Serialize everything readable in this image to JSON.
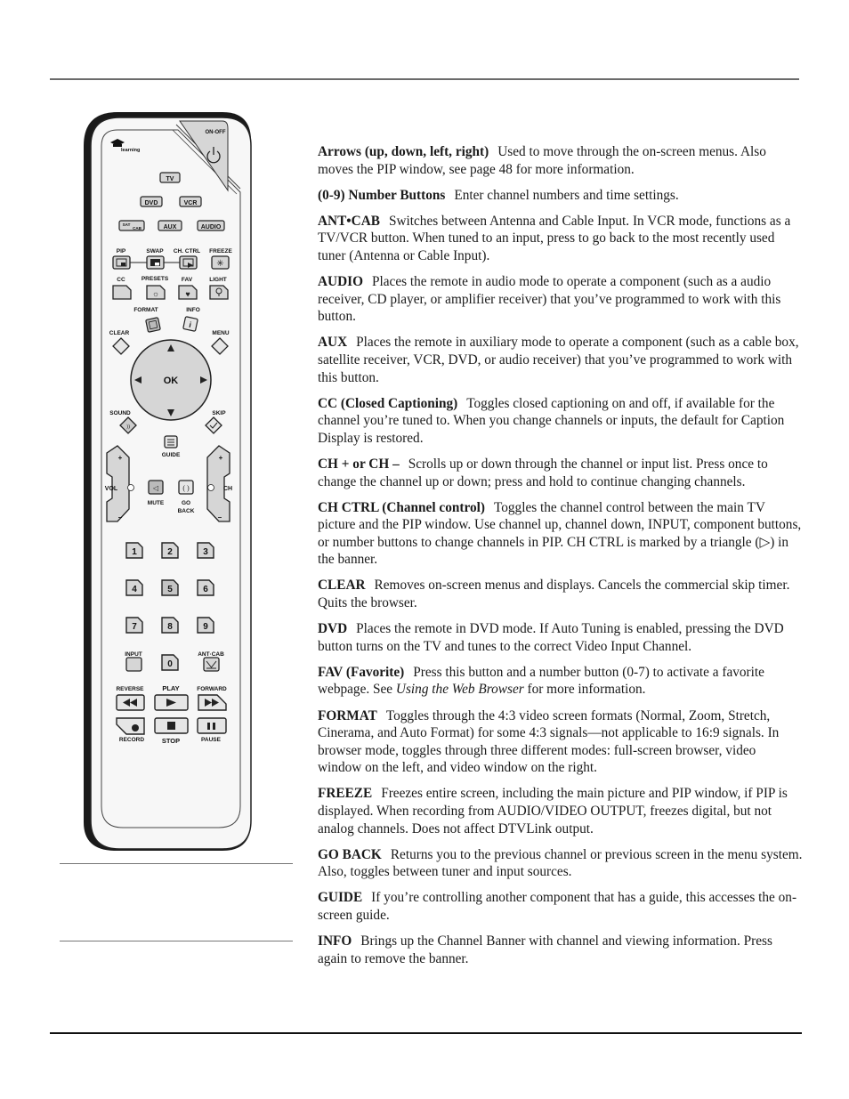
{
  "remote": {
    "labels": {
      "on_off": "ON-OFF",
      "learning": "learning",
      "tv": "TV",
      "dvd": "DVD",
      "vcr": "VCR",
      "sat_cab_top": "SAT",
      "sat_cab_bottom": "CAB",
      "aux": "AUX",
      "audio": "AUDIO",
      "pip": "PIP",
      "swap": "SWAP",
      "ch_ctrl": "CH. CTRL",
      "freeze": "FREEZE",
      "cc": "CC",
      "presets": "PRESETS",
      "fav": "FAV",
      "light": "LIGHT",
      "format": "FORMAT",
      "info": "INFO",
      "clear": "CLEAR",
      "menu": "MENU",
      "ok": "OK",
      "sound": "SOUND",
      "skip": "SKIP",
      "guide": "GUIDE",
      "vol": "VOL",
      "ch": "CH",
      "plus": "+",
      "minus": "–",
      "mute": "MUTE",
      "go": "GO",
      "back": "BACK",
      "n1": "1",
      "n2": "2",
      "n3": "3",
      "n4": "4",
      "n5": "5",
      "n6": "6",
      "n7": "7",
      "n8": "8",
      "n9": "9",
      "n0": "0",
      "input": "INPUT",
      "ant_cab": "ANT·CAB",
      "reverse": "REVERSE",
      "play": "PLAY",
      "forward": "FORWARD",
      "record": "RECORD",
      "stop": "STOP",
      "pause": "PAUSE"
    }
  },
  "entries": [
    {
      "term": "Arrows (up, down, left, right)",
      "desc": "Used to move through the on-screen menus. Also moves the PIP window, see page 48 for more information."
    },
    {
      "term": "(0-9) Number Buttons",
      "desc": "Enter channel numbers and time settings."
    },
    {
      "term": "ANT•CAB",
      "desc": "Switches between Antenna and Cable Input. In VCR mode, functions as a TV/VCR button. When tuned to an input, press to go back to the most recently used tuner (Antenna or Cable Input)."
    },
    {
      "term": "AUDIO",
      "desc": "Places the remote in audio mode to operate a component (such as a audio receiver, CD player, or amplifier receiver) that you’ve programmed to work with this button."
    },
    {
      "term": "AUX",
      "desc": "Places the remote in auxiliary mode to operate a component (such as a cable box, satellite receiver, VCR, DVD, or audio receiver) that you’ve programmed to work with this button."
    },
    {
      "term": "CC (Closed Captioning)",
      "desc": "Toggles closed captioning on and off, if available for the channel you’re tuned to. When you change channels or inputs, the default for Caption Display is restored."
    },
    {
      "term": "CH + or CH –",
      "desc": "Scrolls up or down through the channel or input list. Press once to change the channel up or down; press and hold to continue changing channels."
    },
    {
      "term": "CH CTRL (Channel control)",
      "desc": "Toggles the channel control between the main TV picture and the PIP window. Use channel up, channel down, INPUT, component buttons, or number buttons to change channels in PIP. CH CTRL is marked by a triangle (▷) in the banner."
    },
    {
      "term": "CLEAR",
      "desc": "Removes on-screen menus and displays. Cancels the commercial skip timer. Quits the browser."
    },
    {
      "term": "DVD",
      "desc": "Places the remote in DVD mode. If Auto Tuning is enabled, pressing the DVD button turns on the TV and tunes to the correct Video Input Channel."
    },
    {
      "term": "FAV (Favorite)",
      "desc_before": "Press this button and a number button (0-7) to activate a favorite webpage. See ",
      "desc_italic": "Using the Web Browser",
      "desc_after": " for more information."
    },
    {
      "term": "FORMAT",
      "desc": "Toggles through the 4:3 video screen formats (Normal, Zoom, Stretch, Cinerama, and Auto Format) for some 4:3 signals—not applicable to 16:9 signals. In browser mode, toggles through three different modes: full-screen browser, video window on the left, and video window on the right."
    },
    {
      "term": "FREEZE",
      "desc": "Freezes entire screen, including the main picture and PIP window, if PIP is displayed. When recording from AUDIO/VIDEO OUTPUT, freezes digital, but not analog channels. Does not affect DTVLink output."
    },
    {
      "term": "GO BACK",
      "desc": "Returns you to the previous channel or previous screen in the menu system. Also, toggles between tuner and input sources."
    },
    {
      "term": "GUIDE",
      "desc": "If you’re controlling another component that has a guide, this accesses the on-screen guide."
    },
    {
      "term": "INFO",
      "desc": "Brings up the Channel Banner with channel and viewing information. Press again to remove the banner."
    }
  ]
}
